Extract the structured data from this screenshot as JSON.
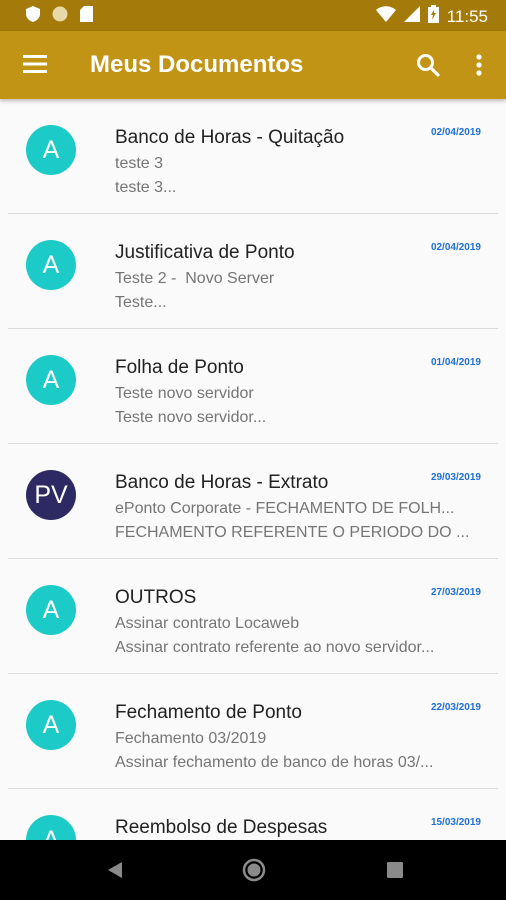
{
  "status_bar": {
    "time": "11:55",
    "icons": [
      "shield-icon",
      "circle-icon",
      "sd-card-icon",
      "wifi-icon",
      "signal-icon",
      "battery-icon"
    ]
  },
  "app_bar": {
    "title": "Meus Documentos",
    "icons": [
      "menu-icon",
      "search-icon",
      "more-vert-icon"
    ],
    "color": "#c19415"
  },
  "documents": [
    {
      "avatar": "A",
      "avatar_color": "#1ccbc7",
      "title": "Banco de Horas - Quitação",
      "line1": "teste 3",
      "line2": "teste 3...",
      "date": "02/04/2019"
    },
    {
      "avatar": "A",
      "avatar_color": "#1ccbc7",
      "title": "Justificativa de Ponto",
      "line1": "Teste 2 -  Novo Server",
      "line2": "Teste...",
      "date": "02/04/2019"
    },
    {
      "avatar": "A",
      "avatar_color": "#1ccbc7",
      "title": "Folha de Ponto",
      "line1": "Teste novo servidor",
      "line2": "Teste novo servidor...",
      "date": "01/04/2019"
    },
    {
      "avatar": "PV",
      "avatar_color": "#2d2a63",
      "title": "Banco de Horas - Extrato",
      "line1": "ePonto Corporate - FECHAMENTO DE FOLH...",
      "line2": "FECHAMENTO REFERENTE O PERIODO DO ...",
      "date": "29/03/2019"
    },
    {
      "avatar": "A",
      "avatar_color": "#1ccbc7",
      "title": "OUTROS",
      "line1": "Assinar contrato Locaweb",
      "line2": "Assinar contrato referente ao novo servidor...",
      "date": "27/03/2019"
    },
    {
      "avatar": "A",
      "avatar_color": "#1ccbc7",
      "title": "Fechamento de Ponto",
      "line1": "Fechamento 03/2019",
      "line2": "Assinar fechamento de banco de horas 03/...",
      "date": "22/03/2019"
    },
    {
      "avatar": "A",
      "avatar_color": "#1ccbc7",
      "title": "Reembolso de Despesas",
      "line1": "",
      "line2": "",
      "date": "15/03/2019"
    }
  ],
  "nav_bar": {
    "icons": [
      "back-icon",
      "home-icon",
      "recents-icon"
    ]
  }
}
